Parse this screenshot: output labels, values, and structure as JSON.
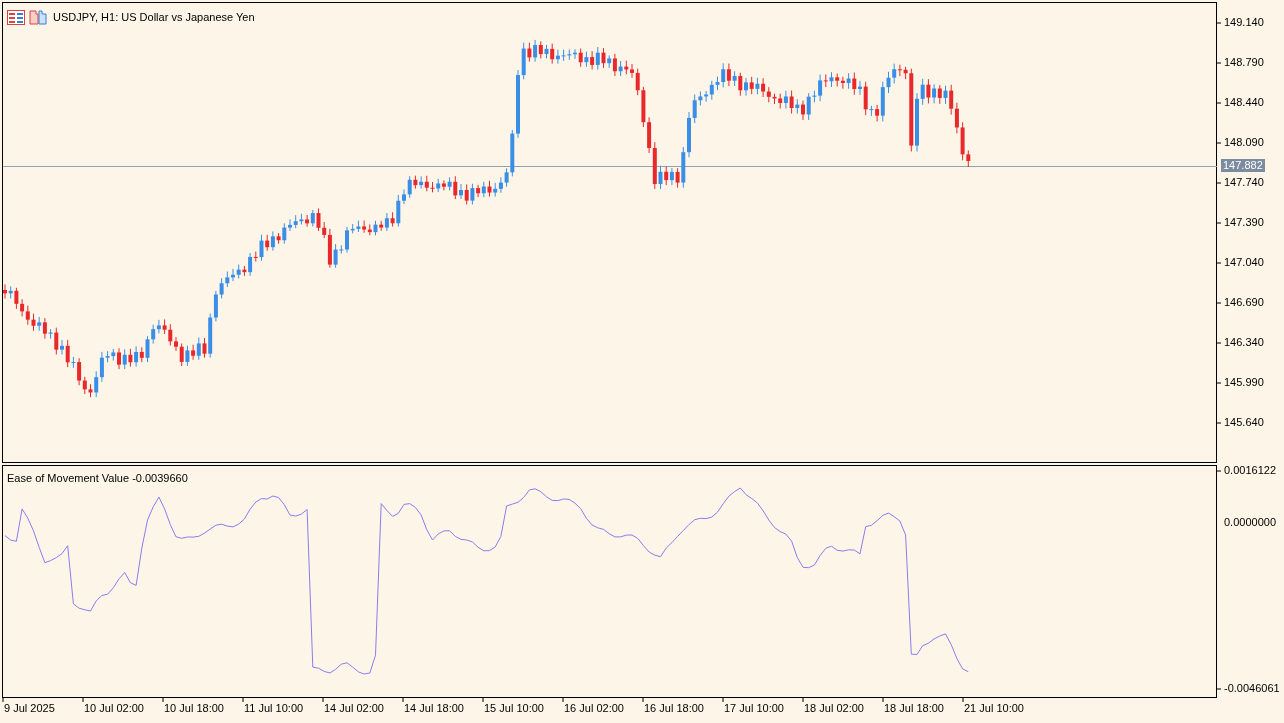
{
  "chart": {
    "title": "USDJPY, H1:  US Dollar vs Japanese Yen",
    "current_price": "147.882",
    "price_axis": [
      "149.140",
      "148.790",
      "148.440",
      "148.090",
      "147.740",
      "147.390",
      "147.040",
      "146.690",
      "146.340",
      "145.990",
      "145.640"
    ]
  },
  "indicator": {
    "label": "Ease of Movement Value -0.0039660",
    "axis": [
      "0.0016122",
      "0.0000000",
      "-0.0046061"
    ]
  },
  "time_axis": [
    "9 Jul 2025",
    "10 Jul 02:00",
    "10 Jul 18:00",
    "11 Jul 10:00",
    "14 Jul 02:00",
    "14 Jul 18:00",
    "15 Jul 10:00",
    "16 Jul 02:00",
    "16 Jul 18:00",
    "17 Jul 10:00",
    "18 Jul 02:00",
    "18 Jul 18:00",
    "21 Jul 10:00"
  ]
}
